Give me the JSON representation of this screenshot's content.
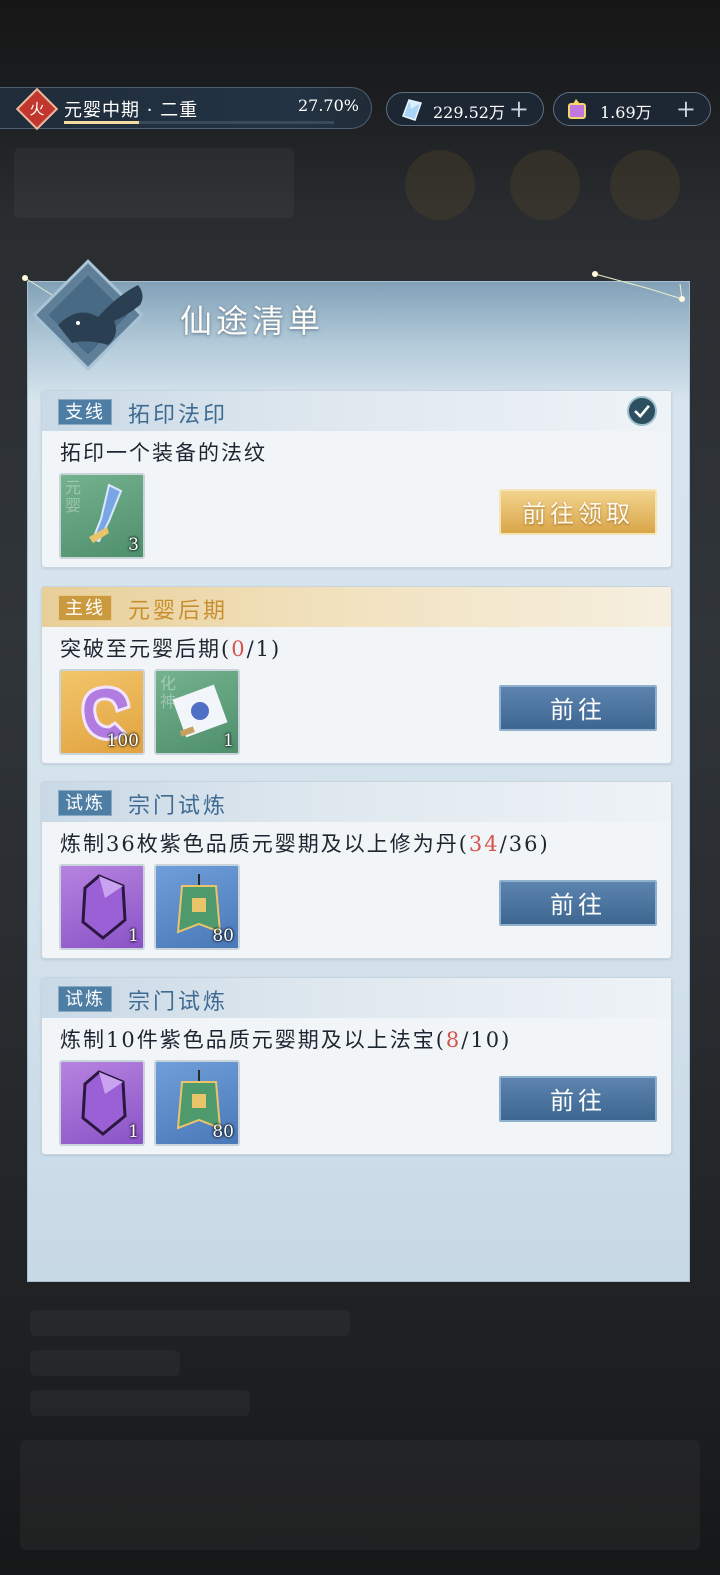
{
  "status_bar": {
    "realm_element": "火",
    "realm_name": "元婴中期 · 二重",
    "realm_progress_text": "27.70%",
    "realm_progress": 0.277,
    "gem_amount": "229.52万",
    "gold_amount": "1.69万",
    "plus_symbol": "+"
  },
  "panel": {
    "title": "仙途清单"
  },
  "tasks": [
    {
      "tag": "支线",
      "title": "拓印法印",
      "description": "拓印一个装备的法纹",
      "completed": true,
      "rewards": [
        {
          "icon": "blue-weapon-icon",
          "count": "3",
          "mark": "元婴",
          "color": "green"
        }
      ],
      "button": "前往领取"
    },
    {
      "tag": "主线",
      "title": "元婴后期",
      "description_prefix": "突破至元婴后期(",
      "progress_current": "0",
      "description_suffix": "/1)",
      "rewards": [
        {
          "icon": "purple-ring-icon",
          "count": "100",
          "color": "gold"
        },
        {
          "icon": "scroll-icon",
          "count": "1",
          "mark": "化神",
          "color": "green"
        }
      ],
      "button": "前往"
    },
    {
      "tag": "试炼",
      "title": "宗门试炼",
      "description_prefix": "炼制36枚紫色品质元婴期及以上修为丹(",
      "progress_current": "34",
      "description_suffix": "/36)",
      "rewards": [
        {
          "icon": "purple-crystal-icon",
          "count": "1",
          "color": "purple"
        },
        {
          "icon": "green-banner-icon",
          "count": "80",
          "color": "blue"
        }
      ],
      "button": "前往"
    },
    {
      "tag": "试炼",
      "title": "宗门试炼",
      "description_prefix": "炼制10件紫色品质元婴期及以上法宝(",
      "progress_current": "8",
      "description_suffix": "/10)",
      "rewards": [
        {
          "icon": "purple-crystal-icon",
          "count": "1",
          "color": "purple"
        },
        {
          "icon": "green-banner-icon",
          "count": "80",
          "color": "blue"
        }
      ],
      "button": "前往"
    }
  ],
  "colors": {
    "progress_red": "#d8534a",
    "tag_blue": "#4f7ea5",
    "tag_gold": "#c99a3e"
  }
}
